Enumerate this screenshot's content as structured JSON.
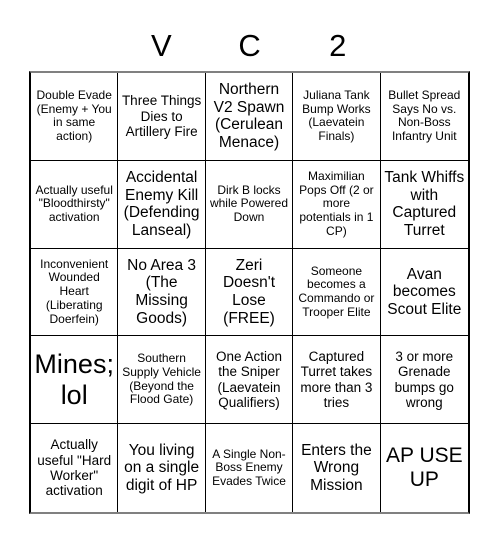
{
  "card": {
    "title_letters": [
      "",
      "V",
      "C",
      "2",
      ""
    ],
    "columns": 5,
    "rows": 5,
    "border_color": "#000000",
    "background_color": "#ffffff",
    "text_color": "#000000",
    "cells": [
      {
        "text": "Double Evade (Enemy + You in same action)",
        "size": "fs-sm",
        "row": 1,
        "col": 1
      },
      {
        "text": "Three Things Dies to Artillery Fire",
        "size": "fs-md",
        "row": 1,
        "col": 2
      },
      {
        "text": "Northern V2 Spawn (Cerulean Menace)",
        "size": "fs-lg",
        "row": 1,
        "col": 3
      },
      {
        "text": "Juliana Tank Bump Works (Laevatein Finals)",
        "size": "fs-sm",
        "row": 1,
        "col": 4
      },
      {
        "text": "Bullet Spread Says No vs. Non-Boss Infantry Unit",
        "size": "fs-sm",
        "row": 1,
        "col": 5
      },
      {
        "text": "Actually useful \"Bloodthirsty\" activation",
        "size": "fs-sm",
        "row": 2,
        "col": 1
      },
      {
        "text": "Accidental Enemy Kill (Defending Lanseal)",
        "size": "fs-lg",
        "row": 2,
        "col": 2
      },
      {
        "text": "Dirk B locks while Powered Down",
        "size": "fs-sm",
        "row": 2,
        "col": 3
      },
      {
        "text": "Maximilian Pops Off (2 or more potentials in 1 CP)",
        "size": "fs-sm",
        "row": 2,
        "col": 4
      },
      {
        "text": "Tank Whiffs with Captured Turret",
        "size": "fs-lg",
        "row": 2,
        "col": 5
      },
      {
        "text": "Inconvenient Wounded Heart (Liberating Doerfein)",
        "size": "fs-sm",
        "row": 3,
        "col": 1
      },
      {
        "text": "No Area 3 (The Missing Goods)",
        "size": "fs-lg",
        "row": 3,
        "col": 2
      },
      {
        "text": "Zeri Doesn't Lose (FREE)",
        "size": "fs-lg",
        "row": 3,
        "col": 3
      },
      {
        "text": "Someone becomes a Commando or Trooper Elite",
        "size": "fs-sm",
        "row": 3,
        "col": 4
      },
      {
        "text": "Avan becomes Scout Elite",
        "size": "fs-lg",
        "row": 3,
        "col": 5
      },
      {
        "text": "Mines; lol",
        "size": "fs-xxl",
        "row": 4,
        "col": 1
      },
      {
        "text": "Southern Supply Vehicle (Beyond the Flood Gate)",
        "size": "fs-sm",
        "row": 4,
        "col": 2
      },
      {
        "text": "One Action the Sniper (Laevatein Qualifiers)",
        "size": "fs-md",
        "row": 4,
        "col": 3
      },
      {
        "text": "Captured Turret takes more than 3 tries",
        "size": "fs-md",
        "row": 4,
        "col": 4
      },
      {
        "text": "3 or more Grenade bumps go wrong",
        "size": "fs-md",
        "row": 4,
        "col": 5
      },
      {
        "text": "Actually useful \"Hard Worker\" activation",
        "size": "fs-md",
        "row": 5,
        "col": 1
      },
      {
        "text": "You living on a single digit of HP",
        "size": "fs-lg",
        "row": 5,
        "col": 2
      },
      {
        "text": "A Single Non-Boss Enemy Evades Twice",
        "size": "fs-sm",
        "row": 5,
        "col": 3
      },
      {
        "text": "Enters the Wrong Mission",
        "size": "fs-lg",
        "row": 5,
        "col": 4
      },
      {
        "text": "AP USE UP",
        "size": "fs-xl",
        "row": 5,
        "col": 5
      }
    ]
  }
}
